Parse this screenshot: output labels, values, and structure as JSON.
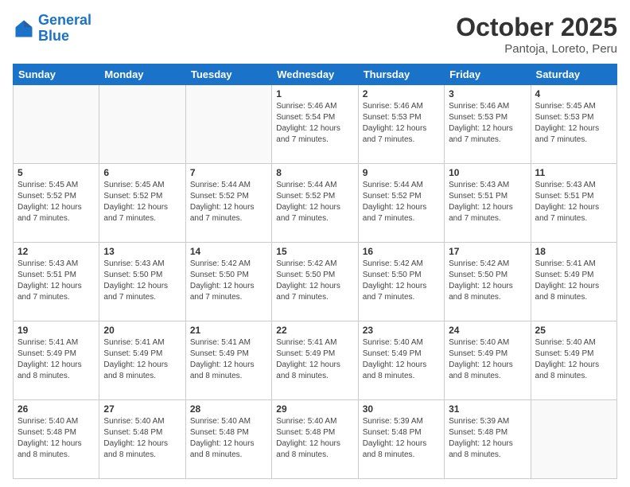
{
  "header": {
    "logo_line1": "General",
    "logo_line2": "Blue",
    "month_title": "October 2025",
    "subtitle": "Pantoja, Loreto, Peru"
  },
  "weekdays": [
    "Sunday",
    "Monday",
    "Tuesday",
    "Wednesday",
    "Thursday",
    "Friday",
    "Saturday"
  ],
  "weeks": [
    [
      {
        "day": "",
        "empty": true
      },
      {
        "day": "",
        "empty": true
      },
      {
        "day": "",
        "empty": true
      },
      {
        "day": "1",
        "sunrise": "5:46 AM",
        "sunset": "5:54 PM",
        "daylight": "12 hours and 7 minutes."
      },
      {
        "day": "2",
        "sunrise": "5:46 AM",
        "sunset": "5:53 PM",
        "daylight": "12 hours and 7 minutes."
      },
      {
        "day": "3",
        "sunrise": "5:46 AM",
        "sunset": "5:53 PM",
        "daylight": "12 hours and 7 minutes."
      },
      {
        "day": "4",
        "sunrise": "5:45 AM",
        "sunset": "5:53 PM",
        "daylight": "12 hours and 7 minutes."
      }
    ],
    [
      {
        "day": "5",
        "sunrise": "5:45 AM",
        "sunset": "5:52 PM",
        "daylight": "12 hours and 7 minutes."
      },
      {
        "day": "6",
        "sunrise": "5:45 AM",
        "sunset": "5:52 PM",
        "daylight": "12 hours and 7 minutes."
      },
      {
        "day": "7",
        "sunrise": "5:44 AM",
        "sunset": "5:52 PM",
        "daylight": "12 hours and 7 minutes."
      },
      {
        "day": "8",
        "sunrise": "5:44 AM",
        "sunset": "5:52 PM",
        "daylight": "12 hours and 7 minutes."
      },
      {
        "day": "9",
        "sunrise": "5:44 AM",
        "sunset": "5:52 PM",
        "daylight": "12 hours and 7 minutes."
      },
      {
        "day": "10",
        "sunrise": "5:43 AM",
        "sunset": "5:51 PM",
        "daylight": "12 hours and 7 minutes."
      },
      {
        "day": "11",
        "sunrise": "5:43 AM",
        "sunset": "5:51 PM",
        "daylight": "12 hours and 7 minutes."
      }
    ],
    [
      {
        "day": "12",
        "sunrise": "5:43 AM",
        "sunset": "5:51 PM",
        "daylight": "12 hours and 7 minutes."
      },
      {
        "day": "13",
        "sunrise": "5:43 AM",
        "sunset": "5:50 PM",
        "daylight": "12 hours and 7 minutes."
      },
      {
        "day": "14",
        "sunrise": "5:42 AM",
        "sunset": "5:50 PM",
        "daylight": "12 hours and 7 minutes."
      },
      {
        "day": "15",
        "sunrise": "5:42 AM",
        "sunset": "5:50 PM",
        "daylight": "12 hours and 7 minutes."
      },
      {
        "day": "16",
        "sunrise": "5:42 AM",
        "sunset": "5:50 PM",
        "daylight": "12 hours and 7 minutes."
      },
      {
        "day": "17",
        "sunrise": "5:42 AM",
        "sunset": "5:50 PM",
        "daylight": "12 hours and 8 minutes."
      },
      {
        "day": "18",
        "sunrise": "5:41 AM",
        "sunset": "5:49 PM",
        "daylight": "12 hours and 8 minutes."
      }
    ],
    [
      {
        "day": "19",
        "sunrise": "5:41 AM",
        "sunset": "5:49 PM",
        "daylight": "12 hours and 8 minutes."
      },
      {
        "day": "20",
        "sunrise": "5:41 AM",
        "sunset": "5:49 PM",
        "daylight": "12 hours and 8 minutes."
      },
      {
        "day": "21",
        "sunrise": "5:41 AM",
        "sunset": "5:49 PM",
        "daylight": "12 hours and 8 minutes."
      },
      {
        "day": "22",
        "sunrise": "5:41 AM",
        "sunset": "5:49 PM",
        "daylight": "12 hours and 8 minutes."
      },
      {
        "day": "23",
        "sunrise": "5:40 AM",
        "sunset": "5:49 PM",
        "daylight": "12 hours and 8 minutes."
      },
      {
        "day": "24",
        "sunrise": "5:40 AM",
        "sunset": "5:49 PM",
        "daylight": "12 hours and 8 minutes."
      },
      {
        "day": "25",
        "sunrise": "5:40 AM",
        "sunset": "5:49 PM",
        "daylight": "12 hours and 8 minutes."
      }
    ],
    [
      {
        "day": "26",
        "sunrise": "5:40 AM",
        "sunset": "5:48 PM",
        "daylight": "12 hours and 8 minutes."
      },
      {
        "day": "27",
        "sunrise": "5:40 AM",
        "sunset": "5:48 PM",
        "daylight": "12 hours and 8 minutes."
      },
      {
        "day": "28",
        "sunrise": "5:40 AM",
        "sunset": "5:48 PM",
        "daylight": "12 hours and 8 minutes."
      },
      {
        "day": "29",
        "sunrise": "5:40 AM",
        "sunset": "5:48 PM",
        "daylight": "12 hours and 8 minutes."
      },
      {
        "day": "30",
        "sunrise": "5:39 AM",
        "sunset": "5:48 PM",
        "daylight": "12 hours and 8 minutes."
      },
      {
        "day": "31",
        "sunrise": "5:39 AM",
        "sunset": "5:48 PM",
        "daylight": "12 hours and 8 minutes."
      },
      {
        "day": "",
        "empty": true
      }
    ]
  ]
}
